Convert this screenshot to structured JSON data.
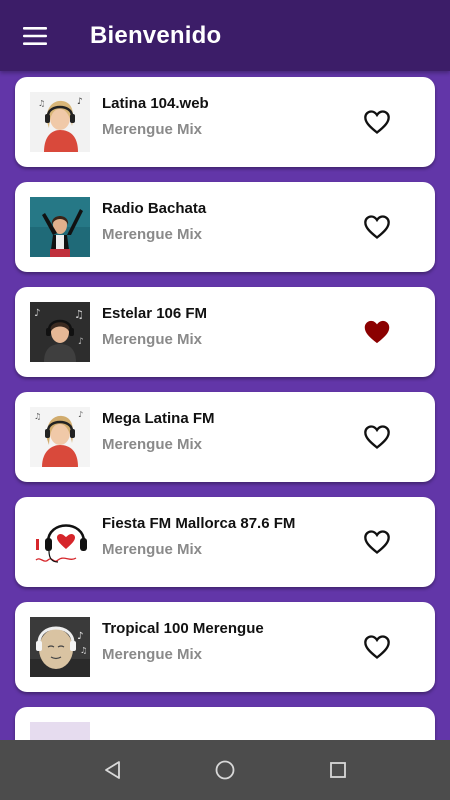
{
  "app_bar": {
    "title": "Bienvenido",
    "menu_icon": "hamburger-menu-icon",
    "background": "#3c1d68"
  },
  "colors": {
    "page_background": "#6236a8",
    "card_background": "#ffffff",
    "favorite_active": "#8b0000",
    "secondary_text": "#8a8a8a"
  },
  "stations": [
    {
      "name": "Latina 104.web",
      "genre": "Merengue Mix",
      "favorite": false,
      "image": "woman-headphones-photo"
    },
    {
      "name": "Radio Bachata",
      "genre": "Merengue Mix",
      "favorite": false,
      "image": "dancing-girl-photo"
    },
    {
      "name": "Estelar 106 FM",
      "genre": "Merengue Mix",
      "favorite": true,
      "image": "girl-headphones-photo"
    },
    {
      "name": "Mega Latina FM",
      "genre": "Merengue Mix",
      "favorite": false,
      "image": "woman-headphones-photo"
    },
    {
      "name": "Fiesta FM Mallorca 87.6 FM",
      "genre": "Merengue Mix",
      "favorite": false,
      "image": "i-love-music-headphones-graphic"
    },
    {
      "name": "Tropical 100 Merengue",
      "genre": "Merengue Mix",
      "favorite": false,
      "image": "egg-headphones-photo"
    }
  ],
  "nav_bar": {
    "back_icon": "back-triangle-icon",
    "home_icon": "home-circle-icon",
    "recents_icon": "recents-square-icon"
  }
}
